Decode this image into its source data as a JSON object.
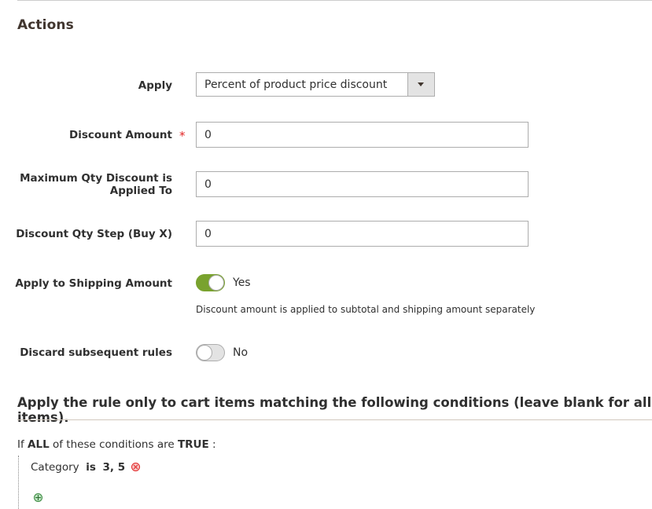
{
  "section": {
    "title": "Actions"
  },
  "fields": {
    "apply": {
      "label": "Apply",
      "value": "Percent of product price discount"
    },
    "discount_amount": {
      "label": "Discount Amount",
      "required_mark": "*",
      "value": "0"
    },
    "max_qty": {
      "label_line1": "Maximum Qty Discount is",
      "label_line2": "Applied To",
      "value": "0"
    },
    "qty_step": {
      "label": "Discount Qty Step (Buy X)",
      "value": "0"
    },
    "apply_shipping": {
      "label": "Apply to Shipping Amount",
      "state": "Yes",
      "note": "Discount amount is applied to subtotal and shipping amount separately"
    },
    "discard_rules": {
      "label": "Discard subsequent rules",
      "state": "No"
    }
  },
  "conditions": {
    "title": "Apply the rule only to cart items matching the following conditions (leave blank for all items).",
    "prefix": "If",
    "aggregator": "ALL",
    "middle": "of these conditions are",
    "value": "TRUE",
    "suffix": ":",
    "items": [
      {
        "attribute": "Category",
        "operator": "is",
        "value": "3, 5"
      }
    ]
  }
}
